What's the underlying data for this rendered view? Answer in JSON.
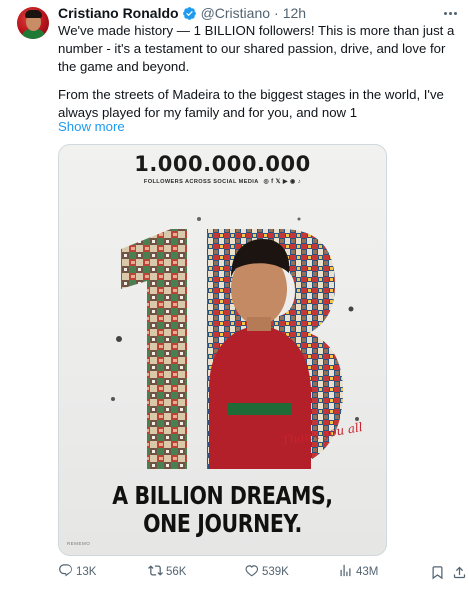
{
  "post": {
    "author_name": "Cristiano Ronaldo",
    "handle": "@Cristiano",
    "separator": "·",
    "time": "12h",
    "text_p1": "We've made history — 1 BILLION followers! This is more than just a number - it's a testament to our shared passion, drive, and love for the game and beyond.",
    "text_p2": "From the streets of Madeira to the biggest stages in the world, I've always played for my family and for you, and now 1",
    "show_more": "Show more"
  },
  "media": {
    "count": "1.000.000.000",
    "subtitle": "FOLLOWERS ACROSS SOCIAL MEDIA",
    "social_icons": "◎ f 𝕏 ▶ ◉ ♪",
    "thanks": "Thank you all",
    "headline_1": "A BILLION DREAMS,",
    "headline_2": "ONE JOURNEY.",
    "brand_mark": "REMEMO"
  },
  "actions": {
    "replies": "13K",
    "reposts": "56K",
    "likes": "539K",
    "views": "43M"
  },
  "colors": {
    "accent": "#1d9bf0",
    "muted": "#536471",
    "text": "#0f1419",
    "red": "#c9222c",
    "green": "#1f7a35"
  },
  "icons": [
    "verified-badge-icon",
    "more-icon",
    "reply-icon",
    "repost-icon",
    "like-icon",
    "views-icon",
    "bookmark-icon",
    "share-icon"
  ]
}
